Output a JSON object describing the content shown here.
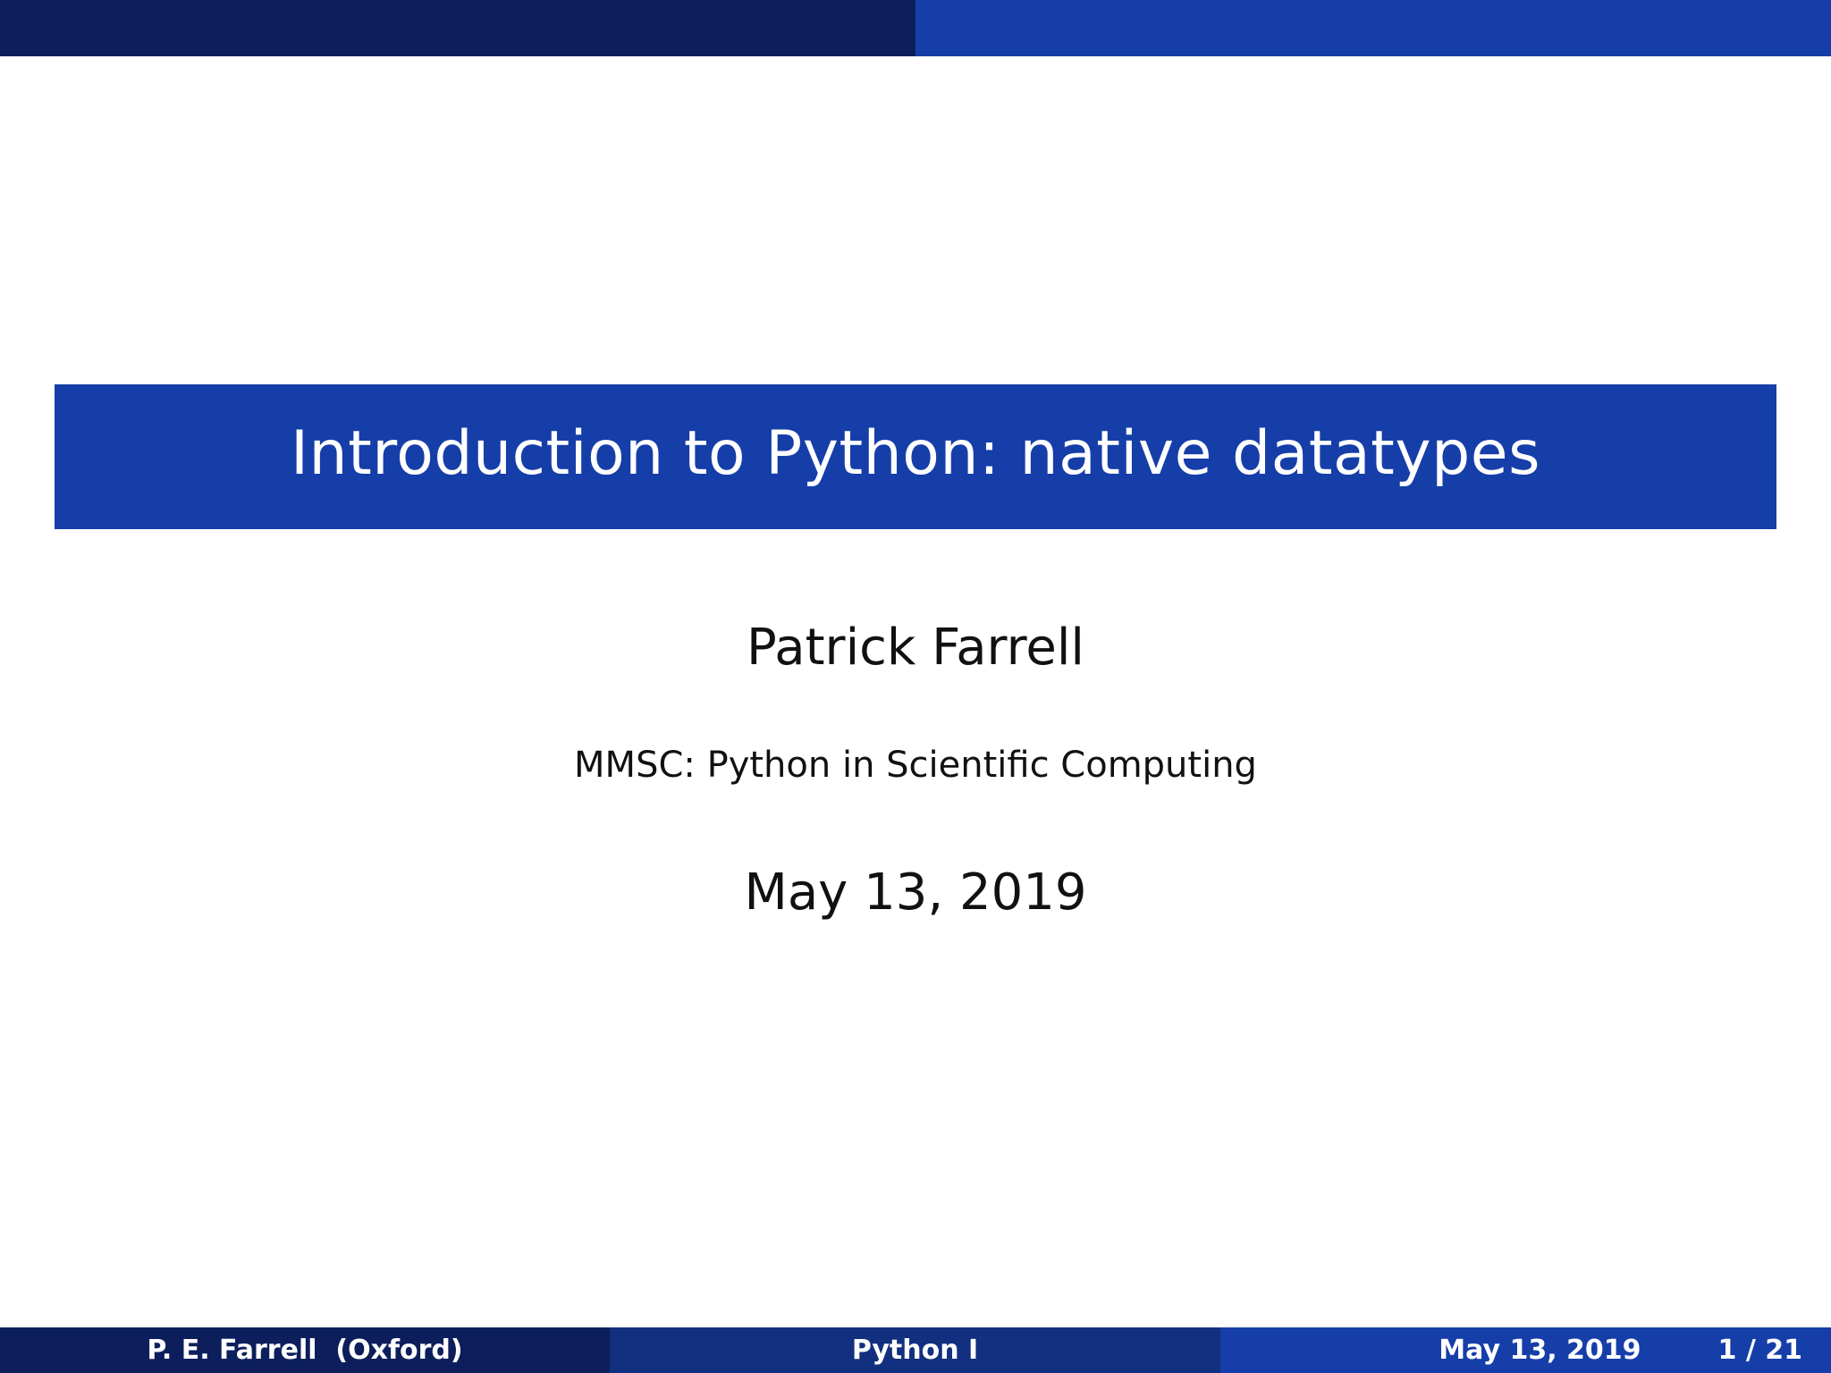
{
  "slide": {
    "title": "Introduction to Python: native datatypes",
    "author": "Patrick Farrell",
    "institute": "MMSC: Python in Scientific Computing",
    "date": "May 13, 2019"
  },
  "footer": {
    "author_short": "P. E. Farrell  (Oxford)",
    "short_title": "Python I",
    "date": "May 13, 2019",
    "page": "1 / 21"
  },
  "colors": {
    "dark_navy": "#0c1f5c",
    "mid_blue": "#12307f",
    "royal_blue": "#163ea9",
    "text": "#111111",
    "background": "#ffffff"
  }
}
